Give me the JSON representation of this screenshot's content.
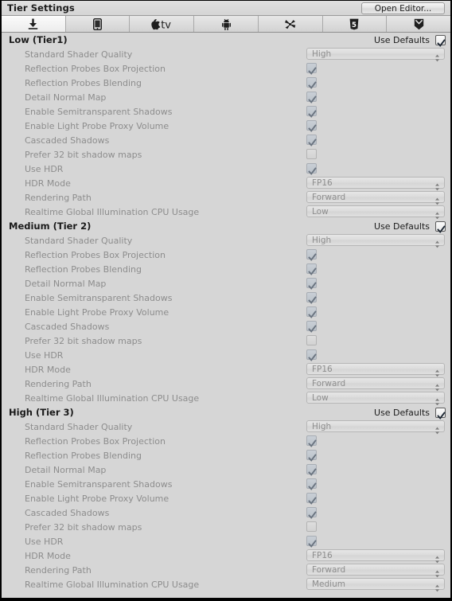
{
  "window": {
    "title": "Tier Settings",
    "open_editor_label": "Open Editor..."
  },
  "tabs": [
    {
      "icon": "standalone-download-icon",
      "label": "",
      "selected": true
    },
    {
      "icon": "ios-device-icon",
      "label": "",
      "selected": false
    },
    {
      "icon": "apple-tv-icon",
      "label": "",
      "selected": false
    },
    {
      "icon": "android-robot-icon",
      "label": "",
      "selected": false
    },
    {
      "icon": "samsung-tv-icon",
      "label": "",
      "selected": false
    },
    {
      "icon": "html5-webgl-icon",
      "label": "",
      "selected": false
    },
    {
      "icon": "facebook-gameroom-icon",
      "label": "",
      "selected": false
    }
  ],
  "use_defaults_label": "Use Defaults",
  "row_labels": [
    "Standard Shader Quality",
    "Reflection Probes Box Projection",
    "Reflection Probes Blending",
    "Detail Normal Map",
    "Enable Semitransparent Shadows",
    "Enable Light Probe Proxy Volume",
    "Cascaded Shadows",
    "Prefer 32 bit shadow maps",
    "Use HDR",
    "HDR Mode",
    "Rendering Path",
    "Realtime Global Illumination CPU Usage"
  ],
  "tiers": [
    {
      "title": "Low (Tier1)",
      "use_defaults": true,
      "rows": [
        {
          "label": "Standard Shader Quality",
          "type": "dropdown",
          "value": "High"
        },
        {
          "label": "Reflection Probes Box Projection",
          "type": "checkbox",
          "checked": true
        },
        {
          "label": "Reflection Probes Blending",
          "type": "checkbox",
          "checked": true
        },
        {
          "label": "Detail Normal Map",
          "type": "checkbox",
          "checked": true
        },
        {
          "label": "Enable Semitransparent Shadows",
          "type": "checkbox",
          "checked": true
        },
        {
          "label": "Enable Light Probe Proxy Volume",
          "type": "checkbox",
          "checked": true
        },
        {
          "label": "Cascaded Shadows",
          "type": "checkbox",
          "checked": true
        },
        {
          "label": "Prefer 32 bit shadow maps",
          "type": "checkbox",
          "checked": false
        },
        {
          "label": "Use HDR",
          "type": "checkbox",
          "checked": true
        },
        {
          "label": "HDR Mode",
          "type": "dropdown",
          "value": "FP16"
        },
        {
          "label": "Rendering Path",
          "type": "dropdown",
          "value": "Forward"
        },
        {
          "label": "Realtime Global Illumination CPU Usage",
          "type": "dropdown",
          "value": "Low"
        }
      ]
    },
    {
      "title": "Medium (Tier 2)",
      "use_defaults": true,
      "rows": [
        {
          "label": "Standard Shader Quality",
          "type": "dropdown",
          "value": "High"
        },
        {
          "label": "Reflection Probes Box Projection",
          "type": "checkbox",
          "checked": true
        },
        {
          "label": "Reflection Probes Blending",
          "type": "checkbox",
          "checked": true
        },
        {
          "label": "Detail Normal Map",
          "type": "checkbox",
          "checked": true
        },
        {
          "label": "Enable Semitransparent Shadows",
          "type": "checkbox",
          "checked": true
        },
        {
          "label": "Enable Light Probe Proxy Volume",
          "type": "checkbox",
          "checked": true
        },
        {
          "label": "Cascaded Shadows",
          "type": "checkbox",
          "checked": true
        },
        {
          "label": "Prefer 32 bit shadow maps",
          "type": "checkbox",
          "checked": false
        },
        {
          "label": "Use HDR",
          "type": "checkbox",
          "checked": true
        },
        {
          "label": "HDR Mode",
          "type": "dropdown",
          "value": "FP16"
        },
        {
          "label": "Rendering Path",
          "type": "dropdown",
          "value": "Forward"
        },
        {
          "label": "Realtime Global Illumination CPU Usage",
          "type": "dropdown",
          "value": "Low"
        }
      ]
    },
    {
      "title": "High (Tier 3)",
      "use_defaults": true,
      "rows": [
        {
          "label": "Standard Shader Quality",
          "type": "dropdown",
          "value": "High"
        },
        {
          "label": "Reflection Probes Box Projection",
          "type": "checkbox",
          "checked": true
        },
        {
          "label": "Reflection Probes Blending",
          "type": "checkbox",
          "checked": true
        },
        {
          "label": "Detail Normal Map",
          "type": "checkbox",
          "checked": true
        },
        {
          "label": "Enable Semitransparent Shadows",
          "type": "checkbox",
          "checked": true
        },
        {
          "label": "Enable Light Probe Proxy Volume",
          "type": "checkbox",
          "checked": true
        },
        {
          "label": "Cascaded Shadows",
          "type": "checkbox",
          "checked": true
        },
        {
          "label": "Prefer 32 bit shadow maps",
          "type": "checkbox",
          "checked": false
        },
        {
          "label": "Use HDR",
          "type": "checkbox",
          "checked": true
        },
        {
          "label": "HDR Mode",
          "type": "dropdown",
          "value": "FP16"
        },
        {
          "label": "Rendering Path",
          "type": "dropdown",
          "value": "Forward"
        },
        {
          "label": "Realtime Global Illumination CPU Usage",
          "type": "dropdown",
          "value": "Medium"
        }
      ]
    }
  ],
  "colors": {
    "window_bg": "#d6d6d6",
    "label_disabled": "#8d8d8d",
    "label_enabled": "#1a1a1a",
    "checkbox_on_fill": "#c5ccd4",
    "checkbox_tick": "#5f6a74",
    "border": "#020202"
  }
}
